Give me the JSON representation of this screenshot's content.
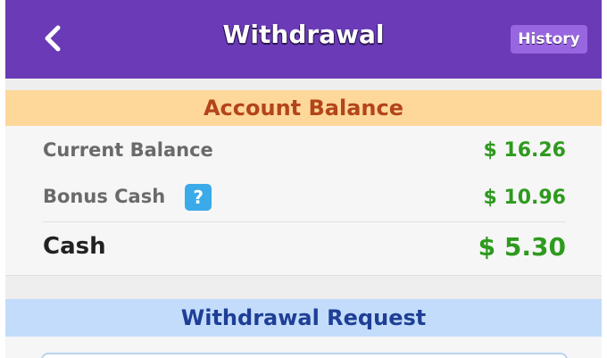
{
  "header": {
    "title": "Withdrawal",
    "history_label": "History"
  },
  "account_balance": {
    "title": "Account Balance",
    "rows": [
      {
        "label": "Current Balance",
        "value": "$ 16.26"
      },
      {
        "label": "Bonus Cash",
        "value": "$ 10.96",
        "help": "?"
      },
      {
        "label": "Cash",
        "value": "$ 5.30"
      }
    ]
  },
  "withdrawal_request": {
    "title": "Withdrawal Request"
  },
  "colors": {
    "header": "#6a3ab7",
    "history_button": "#9866e0",
    "balance_header_bg": "#fdd89a",
    "balance_header_text": "#b4441a",
    "request_header_bg": "#c3dcfb",
    "request_header_text": "#1f3f96",
    "money_green": "#2e9a1e",
    "help_icon": "#3aaae8"
  }
}
